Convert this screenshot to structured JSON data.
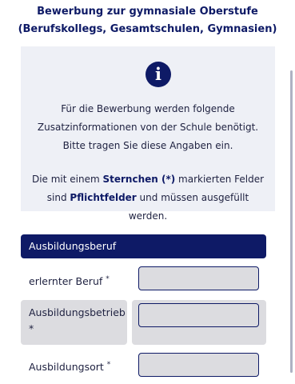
{
  "header": {
    "title_line1": "Bewerbung zur gymnasiale Oberstufe",
    "title_line2": "(Berufskollegs, Gesamtschulen, Gymnasien)"
  },
  "info": {
    "icon": "info-icon",
    "icon_glyph": "i",
    "line1": "Für die Bewerbung werden folgende",
    "line2": "Zusatzinformationen von der Schule benötigt.",
    "line3": "Bitte tragen Sie diese Angaben ein.",
    "line4_pre": "Die mit einem ",
    "line4_bold": "Sternchen (*)",
    "line4_post": " markierten Felder",
    "line5_pre": "sind ",
    "line5_bold": "Pflichtfelder",
    "line5_post": " und müssen ausgefüllt werden."
  },
  "section": {
    "title": "Ausbildungsberuf"
  },
  "fields": [
    {
      "label": "erlernter Beruf",
      "required_mark": "*",
      "value": ""
    },
    {
      "label_line1": "Ausbildungsbetrieb",
      "required_mark": "*",
      "value": ""
    },
    {
      "label": "Ausbildungsort",
      "required_mark": "*",
      "value": ""
    }
  ],
  "colors": {
    "primary": "#0e1a66",
    "info_bg": "#eef0f6",
    "field_bg": "#dcdce0"
  }
}
